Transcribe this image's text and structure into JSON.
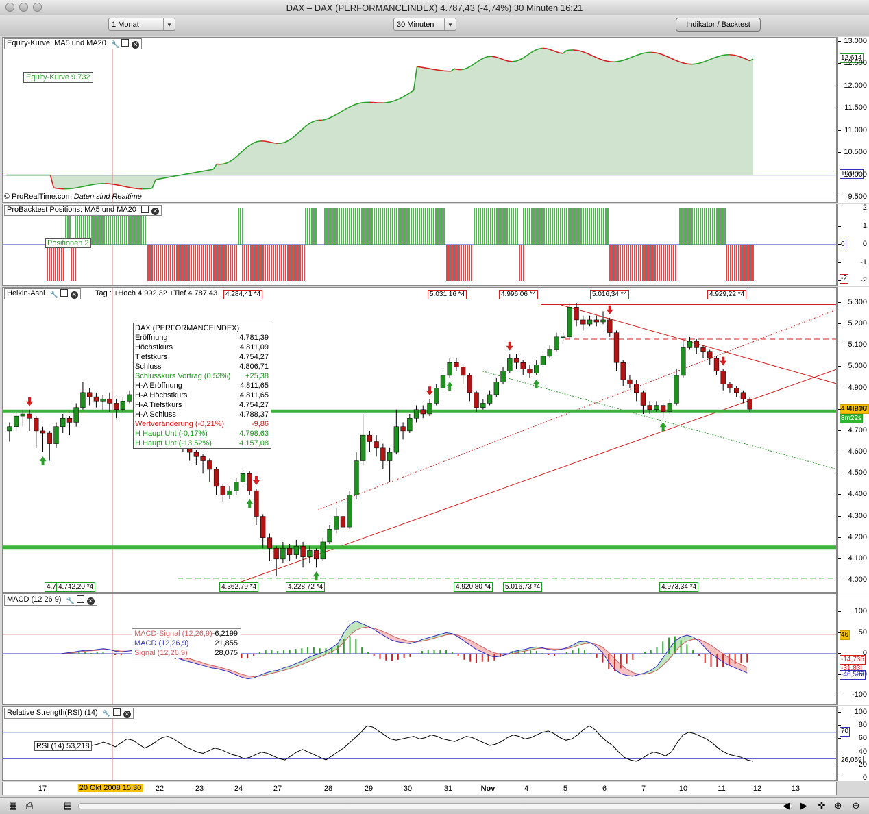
{
  "window": {
    "title": "DAX – DAX (PERFORMANCEINDEX)    4.787,43 (-4,74%)    30 Minuten  16:21"
  },
  "toolbar": {
    "period": "1 Monat",
    "interval": "30 Minuten",
    "indicator_button": "Indikator / Backtest"
  },
  "colors": {
    "up": "#2aa02a",
    "down": "#d42020",
    "support": "#3cb43c",
    "equity_fill": "#cfe3cf"
  },
  "equity": {
    "title": "Equity-Kurve: MA5 und MA20",
    "legend": "Equity-Kurve 9.732",
    "footer_brand": "© ProRealTime.com",
    "footer_note": "Daten sind Realtime",
    "ticks": [
      "13.000",
      "12.500",
      "12.000",
      "11.500",
      "11.000",
      "10.500",
      "10.000",
      "9.500"
    ],
    "tag_last": "12.614",
    "tag_base": "10.000"
  },
  "positions": {
    "title": "ProBacktest Positions: MA5 und MA20",
    "legend": "Positionen 2",
    "ticks": [
      "2",
      "1",
      "0",
      "-1",
      "-2"
    ],
    "tag_zero": "0",
    "tag_last": "-2"
  },
  "price": {
    "title": "Heikin-Ashi",
    "header_text": "Tag : +Hoch 4.992,32 +Tief 4.787,43",
    "ticks": [
      "5.300",
      "5.200",
      "5.100",
      "5.000",
      "4.900",
      "4.800",
      "4.700",
      "4.600",
      "4.500",
      "4.400",
      "4.300",
      "4.200",
      "4.100",
      "4.000"
    ],
    "tag_last": "4.802,87",
    "tag_timer": "8m22s",
    "highs": [
      "4.284,41 *4",
      "5.031,16 *4",
      "4.996,06 *4",
      "5.016,34 *4",
      "4.929,22 *4"
    ],
    "lows": [
      "4.742,20 *4",
      "4.362,79 *4",
      "4.228,72 *4",
      "4.920,80 *4",
      "5.016,73 *4",
      "4.973,34 *4"
    ],
    "low_partial": "4.7",
    "info": {
      "header": "DAX (PERFORMANCEINDEX)",
      "rows": [
        {
          "label": "Eröffnung",
          "value": "4.781,39",
          "color": "#000"
        },
        {
          "label": "Höchstkurs",
          "value": "4.811,09",
          "color": "#000"
        },
        {
          "label": "Tiefstkurs",
          "value": "4.754,27",
          "color": "#000"
        },
        {
          "label": "Schluss",
          "value": "4.806,71",
          "color": "#000"
        },
        {
          "label": "Schlusskurs Vortrag (0,53%)",
          "value": "+25,38",
          "color": "#1a9a1a"
        },
        {
          "label": "H-A Eröffnung",
          "value": "4.811,65",
          "color": "#000"
        },
        {
          "label": "H-A Höchstkurs",
          "value": "4.811,65",
          "color": "#000"
        },
        {
          "label": "H-A Tiefstkurs",
          "value": "4.754,27",
          "color": "#000"
        },
        {
          "label": "H-A Schluss",
          "value": "4.788,37",
          "color": "#000"
        },
        {
          "label": "Wertveränderung (-0,21%)",
          "value": "-9,86",
          "color": "#c81e1e"
        },
        {
          "label": "H Haupt Unt (-0,17%)",
          "value": "4.798,63",
          "color": "#1a9a1a"
        },
        {
          "label": "H Haupt Unt (-13,52%)",
          "value": "4.157,08",
          "color": "#1a9a1a"
        }
      ]
    },
    "support_levels": [
      4792,
      4155
    ],
    "resistance_levels": [
      5292,
      5130
    ],
    "candles": [
      [
        4700,
        4720,
        4650,
        4740
      ],
      [
        4720,
        4770,
        4700,
        4790
      ],
      [
        4770,
        4780,
        4720,
        4800
      ],
      [
        4780,
        4760,
        4700,
        4800
      ],
      [
        4760,
        4700,
        4620,
        4770
      ],
      [
        4700,
        4690,
        4600,
        4720
      ],
      [
        4690,
        4640,
        4560,
        4700
      ],
      [
        4640,
        4720,
        4620,
        4740
      ],
      [
        4720,
        4760,
        4690,
        4780
      ],
      [
        4760,
        4740,
        4680,
        4770
      ],
      [
        4740,
        4810,
        4720,
        4830
      ],
      [
        4810,
        4880,
        4800,
        4930
      ],
      [
        4880,
        4860,
        4820,
        4900
      ],
      [
        4860,
        4840,
        4810,
        4880
      ],
      [
        4840,
        4850,
        4800,
        4870
      ],
      [
        4850,
        4830,
        4790,
        4880
      ],
      [
        4830,
        4800,
        4760,
        4850
      ],
      [
        4800,
        4840,
        4790,
        4860
      ],
      [
        4840,
        4870,
        4830,
        4890
      ],
      [
        4870,
        4860,
        4830,
        4880
      ],
      [
        4860,
        4830,
        4800,
        4880
      ],
      [
        4830,
        4790,
        4760,
        4850
      ],
      [
        4790,
        4770,
        4740,
        4800
      ],
      [
        4770,
        4760,
        4720,
        4780
      ],
      [
        4760,
        4720,
        4690,
        4770
      ],
      [
        4720,
        4680,
        4650,
        4730
      ],
      [
        4680,
        4640,
        4600,
        4690
      ],
      [
        4640,
        4600,
        4560,
        4650
      ],
      [
        4600,
        4580,
        4540,
        4610
      ],
      [
        4580,
        4560,
        4500,
        4590
      ],
      [
        4560,
        4520,
        4460,
        4570
      ],
      [
        4520,
        4440,
        4400,
        4530
      ],
      [
        4440,
        4400,
        4370,
        4450
      ],
      [
        4400,
        4420,
        4380,
        4440
      ],
      [
        4420,
        4460,
        4400,
        4480
      ],
      [
        4460,
        4500,
        4440,
        4520
      ],
      [
        4500,
        4420,
        4400,
        4510
      ],
      [
        4420,
        4300,
        4260,
        4430
      ],
      [
        4300,
        4200,
        4150,
        4310
      ],
      [
        4200,
        4150,
        4090,
        4220
      ],
      [
        4150,
        4100,
        4020,
        4160
      ],
      [
        4100,
        4150,
        4080,
        4180
      ],
      [
        4150,
        4120,
        4090,
        4170
      ],
      [
        4120,
        4160,
        4100,
        4190
      ],
      [
        4160,
        4110,
        4060,
        4180
      ],
      [
        4110,
        4140,
        4080,
        4160
      ],
      [
        4140,
        4100,
        4060,
        4150
      ],
      [
        4100,
        4180,
        4090,
        4200
      ],
      [
        4180,
        4240,
        4170,
        4260
      ],
      [
        4240,
        4300,
        4220,
        4340
      ],
      [
        4300,
        4250,
        4200,
        4310
      ],
      [
        4250,
        4400,
        4240,
        4420
      ],
      [
        4400,
        4560,
        4380,
        4600
      ],
      [
        4560,
        4680,
        4540,
        4780
      ],
      [
        4680,
        4650,
        4600,
        4700
      ],
      [
        4650,
        4620,
        4580,
        4680
      ],
      [
        4620,
        4560,
        4520,
        4640
      ],
      [
        4560,
        4600,
        4460,
        4620
      ],
      [
        4600,
        4720,
        4590,
        4800
      ],
      [
        4720,
        4700,
        4660,
        4740
      ],
      [
        4700,
        4760,
        4690,
        4780
      ],
      [
        4760,
        4800,
        4740,
        4820
      ],
      [
        4800,
        4780,
        4760,
        4820
      ],
      [
        4780,
        4830,
        4770,
        4850
      ],
      [
        4830,
        4900,
        4820,
        4920
      ],
      [
        4900,
        4960,
        4890,
        4980
      ],
      [
        4960,
        5020,
        4950,
        5040
      ],
      [
        5020,
        5000,
        4980,
        5040
      ],
      [
        5000,
        4960,
        4920,
        5010
      ],
      [
        4960,
        4880,
        4840,
        4970
      ],
      [
        4880,
        4810,
        4790,
        4890
      ],
      [
        4810,
        4830,
        4800,
        4850
      ],
      [
        4830,
        4870,
        4820,
        4890
      ],
      [
        4870,
        4930,
        4860,
        4950
      ],
      [
        4930,
        4980,
        4920,
        5000
      ],
      [
        4980,
        5040,
        4970,
        5060
      ],
      [
        5040,
        5020,
        4990,
        5060
      ],
      [
        5020,
        4990,
        4960,
        5030
      ],
      [
        4990,
        4970,
        4950,
        5010
      ],
      [
        4970,
        5010,
        4960,
        5030
      ],
      [
        5010,
        5050,
        5000,
        5070
      ],
      [
        5050,
        5080,
        5040,
        5100
      ],
      [
        5080,
        5140,
        5070,
        5160
      ],
      [
        5140,
        5140,
        5120,
        5160
      ],
      [
        5140,
        5280,
        5130,
        5300
      ],
      [
        5280,
        5220,
        5190,
        5300
      ],
      [
        5220,
        5200,
        5170,
        5240
      ],
      [
        5200,
        5220,
        5190,
        5240
      ],
      [
        5220,
        5210,
        5190,
        5240
      ],
      [
        5210,
        5220,
        5200,
        5260
      ],
      [
        5220,
        5160,
        5140,
        5230
      ],
      [
        5160,
        5020,
        4980,
        5170
      ],
      [
        5020,
        4940,
        4910,
        5030
      ],
      [
        4940,
        4920,
        4900,
        4960
      ],
      [
        4920,
        4880,
        4840,
        4940
      ],
      [
        4880,
        4820,
        4780,
        4890
      ],
      [
        4820,
        4800,
        4780,
        4840
      ],
      [
        4800,
        4820,
        4790,
        4840
      ],
      [
        4820,
        4790,
        4760,
        4830
      ],
      [
        4790,
        4830,
        4780,
        4850
      ],
      [
        4830,
        4960,
        4820,
        4990
      ],
      [
        4960,
        5090,
        4950,
        5120
      ],
      [
        5090,
        5120,
        5080,
        5140
      ],
      [
        5120,
        5090,
        5060,
        5130
      ],
      [
        5090,
        5070,
        5040,
        5100
      ],
      [
        5070,
        5040,
        5010,
        5080
      ],
      [
        5040,
        4980,
        4960,
        5050
      ],
      [
        4980,
        4920,
        4890,
        4990
      ],
      [
        4920,
        4900,
        4880,
        4930
      ],
      [
        4900,
        4880,
        4860,
        4910
      ],
      [
        4880,
        4850,
        4830,
        4890
      ],
      [
        4850,
        4802,
        4790,
        4860
      ]
    ],
    "arrows_down_idx": [
      3,
      37,
      63,
      75,
      90,
      107
    ],
    "arrows_up_idx": [
      5,
      36,
      46,
      66,
      79,
      98
    ]
  },
  "macd": {
    "title": "MACD (12 26 9)",
    "legend": [
      {
        "label": "MACD-Signal (12,26,9)",
        "value": "-6,2199",
        "color": "#d06060"
      },
      {
        "label": "MACD (12,26,9)",
        "value": "21,855",
        "color": "#3030c0"
      },
      {
        "label": "Signal (12,26,9)",
        "value": "28,075",
        "color": "#d06060"
      }
    ],
    "ticks": [
      "100",
      "50",
      "0",
      "-50",
      "-100"
    ],
    "tag_top": "46",
    "tag_values": [
      "-14,735",
      "-31,83",
      "-46,565"
    ],
    "macd": [
      0,
      2,
      4,
      6,
      8,
      8,
      10,
      12,
      10,
      6,
      4,
      6,
      8,
      10,
      14,
      14,
      10,
      4,
      -2,
      -8,
      -14,
      -18,
      -22,
      -26,
      -30,
      -34,
      -36,
      -40,
      -44,
      -50,
      -56,
      -60,
      -58,
      -52,
      -46,
      -42,
      -40,
      -34,
      -30,
      -24,
      -18,
      -10,
      -4,
      0,
      6,
      14,
      24,
      50,
      70,
      78,
      72,
      66,
      58,
      48,
      40,
      32,
      28,
      26,
      24,
      28,
      34,
      38,
      42,
      46,
      50,
      48,
      40,
      30,
      20,
      10,
      4,
      -4,
      -8,
      -6,
      -2,
      4,
      8,
      10,
      14,
      16,
      14,
      10,
      8,
      10,
      14,
      20,
      28,
      30,
      26,
      16,
      2,
      -20,
      -38,
      -48,
      -52,
      -54,
      -50,
      -46,
      -40,
      -30,
      -10,
      10,
      30,
      40,
      44,
      40,
      30,
      14,
      0,
      -10,
      -20,
      -28,
      -34,
      -40,
      -46
    ],
    "signal": [
      0,
      1,
      2,
      4,
      6,
      7,
      8,
      10,
      10,
      8,
      6,
      6,
      7,
      8,
      11,
      12,
      11,
      8,
      4,
      0,
      -5,
      -10,
      -15,
      -19,
      -24,
      -28,
      -31,
      -35,
      -39,
      -44,
      -49,
      -53,
      -55,
      -54,
      -51,
      -47,
      -44,
      -40,
      -36,
      -31,
      -26,
      -20,
      -14,
      -8,
      -2,
      5,
      12,
      28,
      44,
      56,
      62,
      64,
      61,
      56,
      50,
      43,
      37,
      33,
      29,
      28,
      30,
      33,
      37,
      41,
      45,
      46,
      44,
      39,
      32,
      24,
      16,
      8,
      2,
      -1,
      -2,
      0,
      3,
      6,
      9,
      12,
      13,
      12,
      11,
      11,
      12,
      15,
      20,
      24,
      25,
      22,
      15,
      3,
      -12,
      -26,
      -37,
      -45,
      -49,
      -49,
      -46,
      -40,
      -28,
      -14,
      4,
      20,
      30,
      34,
      34,
      28,
      20,
      10,
      0,
      -10,
      -19,
      -26,
      -33
    ]
  },
  "rsi": {
    "title": "Relative Strength(RSI) (14)",
    "legend": "RSI (14) 53,218",
    "ticks": [
      "100",
      "80",
      "60",
      "40",
      "20",
      "0"
    ],
    "tag_70": "70",
    "tag_last": "26,059",
    "values": [
      50,
      52,
      55,
      52,
      48,
      54,
      60,
      58,
      52,
      46,
      50,
      56,
      62,
      64,
      60,
      54,
      48,
      44,
      40,
      38,
      42,
      46,
      44,
      40,
      36,
      34,
      30,
      32,
      36,
      40,
      38,
      34,
      30,
      28,
      34,
      40,
      44,
      40,
      36,
      32,
      28,
      34,
      40,
      46,
      54,
      62,
      70,
      80,
      78,
      72,
      66,
      60,
      58,
      60,
      62,
      64,
      60,
      62,
      66,
      64,
      60,
      58,
      56,
      60,
      64,
      62,
      58,
      54,
      50,
      52,
      56,
      62,
      66,
      64,
      60,
      62,
      66,
      70,
      72,
      68,
      62,
      58,
      60,
      66,
      74,
      80,
      74,
      64,
      56,
      50,
      40,
      32,
      28,
      26,
      30,
      36,
      40,
      38,
      34,
      40,
      54,
      66,
      70,
      68,
      64,
      60,
      54,
      46,
      40,
      36,
      34,
      32,
      28,
      26
    ]
  },
  "dates": {
    "labels": [
      "17",
      "20 Okt 2008 15:30",
      "22",
      "23",
      "24",
      "27",
      "28",
      "29",
      "30",
      "31",
      "Nov",
      "4",
      "5",
      "6",
      "7",
      "10",
      "11",
      "12",
      "13"
    ]
  },
  "bottom": {
    "icons": [
      "printer-icon",
      "zoom-in-icon",
      "zoom-out-icon"
    ]
  }
}
